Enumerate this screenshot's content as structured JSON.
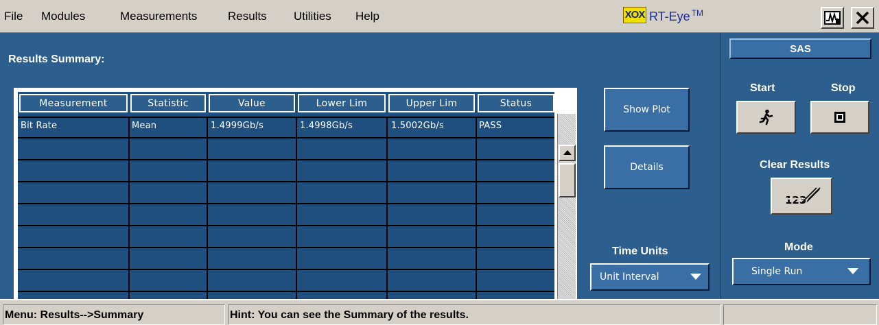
{
  "menu": {
    "items": [
      "File",
      "Modules",
      "Measurements",
      "Results",
      "Utilities",
      "Help"
    ]
  },
  "app": {
    "logo_text": "XOX",
    "title": "RT-Eye",
    "trademark": "TM"
  },
  "main": {
    "section_title": "Results Summary:",
    "table": {
      "columns": [
        "Measurement",
        "Statistic",
        "Value",
        "Lower Lim",
        "Upper Lim",
        "Status"
      ],
      "rows": [
        [
          "Bit Rate",
          "Mean",
          "1.4999Gb/s",
          "1.4998Gb/s",
          "1.5002Gb/s",
          "PASS"
        ]
      ]
    },
    "show_plot_label": "Show Plot",
    "details_label": "Details",
    "time_units_label": "Time Units",
    "time_units_value": "Unit Interval"
  },
  "right": {
    "standard": "SAS",
    "start_label": "Start",
    "stop_label": "Stop",
    "clear_results_label": "Clear Results",
    "clear_icon_text": "123",
    "mode_label": "Mode",
    "mode_value": "Single Run"
  },
  "status": {
    "menu_path": "Menu: Results-->Summary",
    "hint": "Hint: You can see the Summary of the results."
  },
  "colors": {
    "panel_blue": "#2c5f8e",
    "grid_blue": "#1f4f7f",
    "button_blue": "#3a6fa5",
    "chrome_gray": "#d4d0c8",
    "logo_yellow": "#f0e000"
  }
}
